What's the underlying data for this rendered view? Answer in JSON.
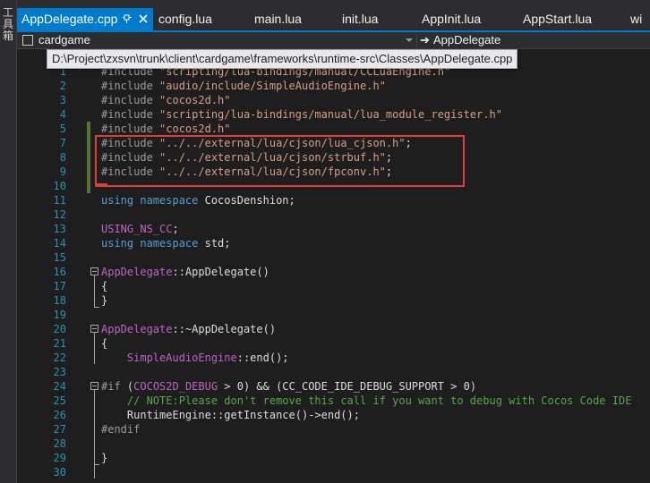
{
  "toolbox": {
    "label": "工具箱"
  },
  "tabs": [
    {
      "label": "AppDelegate.cpp",
      "active": true
    },
    {
      "label": "config.lua"
    },
    {
      "label": "main.lua"
    },
    {
      "label": "init.lua"
    },
    {
      "label": "AppInit.lua"
    },
    {
      "label": "AppStart.lua"
    },
    {
      "label": "wi"
    }
  ],
  "tab_icons": {
    "pin": "pin-icon",
    "close": "close-icon"
  },
  "nav": {
    "project": "cardgame",
    "member": "AppDelegate"
  },
  "tooltip": {
    "path": "D:\\Project\\zxsvn\\trunk\\client\\cardgame\\frameworks\\runtime-src\\Classes\\AppDelegate.cpp"
  },
  "colors": {
    "accent": "#007acc",
    "editor_bg": "#1e1e1e",
    "highlight_box": "#e03c3c",
    "change_bar": "#577430"
  },
  "editor": {
    "lines": [
      {
        "n": "1",
        "parts": [
          [
            "pp",
            "#include "
          ],
          [
            "str",
            "\"scripting/lua-bindings/manual/CCLuaEngine.h\""
          ]
        ]
      },
      {
        "n": "2",
        "parts": [
          [
            "pp",
            "#include "
          ],
          [
            "str",
            "\"audio/include/SimpleAudioEngine.h\""
          ]
        ]
      },
      {
        "n": "3",
        "parts": [
          [
            "pp",
            "#include "
          ],
          [
            "str",
            "\"cocos2d.h\""
          ]
        ]
      },
      {
        "n": "4",
        "parts": [
          [
            "pp",
            "#include "
          ],
          [
            "str",
            "\"scripting/lua-bindings/manual/lua_module_register.h\""
          ]
        ]
      },
      {
        "n": "5",
        "parts": [
          [
            "pp",
            "#include "
          ],
          [
            "str",
            "\"cocos2d.h\""
          ]
        ]
      },
      {
        "n": "7",
        "parts": [
          [
            "pp",
            "#include "
          ],
          [
            "str",
            "\"../../external/lua/cjson/lua_cjson.h\""
          ],
          [
            "txt",
            ";"
          ]
        ]
      },
      {
        "n": "8",
        "parts": [
          [
            "pp",
            "#include "
          ],
          [
            "str",
            "\"../../external/lua/cjson/strbuf.h\""
          ],
          [
            "txt",
            ";"
          ]
        ]
      },
      {
        "n": "9",
        "parts": [
          [
            "pp",
            "#include "
          ],
          [
            "str",
            "\"../../external/lua/cjson/fpconv.h\""
          ],
          [
            "txt",
            ";"
          ]
        ]
      },
      {
        "n": "10",
        "parts": []
      },
      {
        "n": "11",
        "parts": [
          [
            "kw",
            "using namespace "
          ],
          [
            "txt",
            "CocosDenshion;"
          ]
        ]
      },
      {
        "n": "12",
        "parts": []
      },
      {
        "n": "13",
        "parts": [
          [
            "mac",
            "USING_NS_CC"
          ],
          [
            "txt",
            ";"
          ]
        ]
      },
      {
        "n": "14",
        "parts": [
          [
            "kw",
            "using namespace "
          ],
          [
            "txt",
            "std;"
          ]
        ]
      },
      {
        "n": "15",
        "parts": []
      },
      {
        "n": "16",
        "parts": [
          [
            "mac",
            "AppDelegate"
          ],
          [
            "txt",
            "::AppDelegate()"
          ]
        ]
      },
      {
        "n": "17",
        "parts": [
          [
            "txt",
            "{"
          ]
        ]
      },
      {
        "n": "18",
        "parts": [
          [
            "txt",
            "}"
          ]
        ]
      },
      {
        "n": "19",
        "parts": []
      },
      {
        "n": "20",
        "parts": [
          [
            "mac",
            "AppDelegate"
          ],
          [
            "txt",
            "::~AppDelegate()"
          ]
        ]
      },
      {
        "n": "21",
        "parts": [
          [
            "txt",
            "{"
          ]
        ]
      },
      {
        "n": "22",
        "parts": [
          [
            "txt",
            "    "
          ],
          [
            "mac",
            "SimpleAudioEngine"
          ],
          [
            "txt",
            "::end();"
          ]
        ]
      },
      {
        "n": "23",
        "parts": []
      },
      {
        "n": "24",
        "parts": [
          [
            "pp",
            "#if "
          ],
          [
            "txt",
            "("
          ],
          [
            "mac",
            "COCOS2D_DEBUG"
          ],
          [
            "txt",
            " > 0) && (CC_CODE_IDE_DEBUG_SUPPORT > 0)"
          ]
        ]
      },
      {
        "n": "25",
        "parts": [
          [
            "txt",
            "    "
          ],
          [
            "cm",
            "// NOTE:Please don't remove this call if you want to debug with Cocos Code IDE"
          ]
        ]
      },
      {
        "n": "26",
        "parts": [
          [
            "txt",
            "    RuntimeEngine::getInstance()->end();"
          ]
        ]
      },
      {
        "n": "27",
        "parts": [
          [
            "pp",
            "#endif"
          ]
        ]
      },
      {
        "n": "28",
        "parts": []
      },
      {
        "n": "29",
        "parts": [
          [
            "txt",
            "}"
          ]
        ]
      },
      {
        "n": "30",
        "parts": []
      }
    ]
  }
}
